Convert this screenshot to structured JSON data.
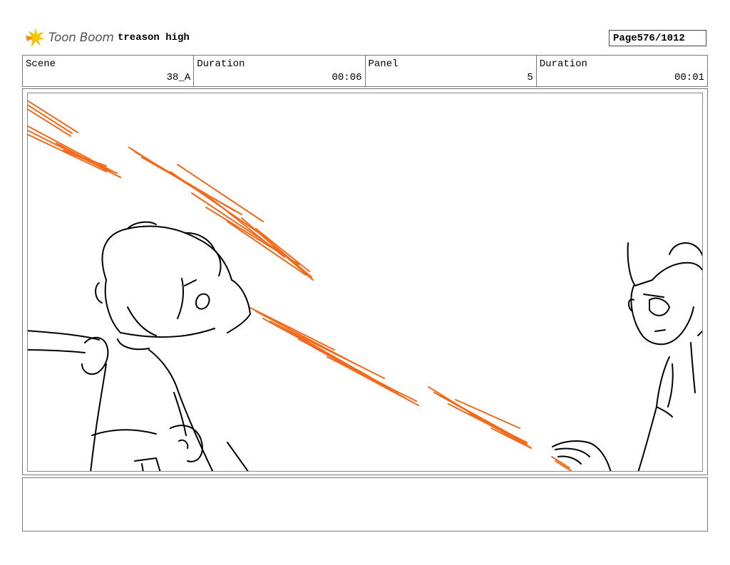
{
  "header": {
    "logo_text": "Toon Boom",
    "project_title": "treason high",
    "page_label": "Page",
    "page_value": "576/1012"
  },
  "info": {
    "scene_label": "Scene",
    "scene_value": "38_A",
    "duration_label": "Duration",
    "duration_value": "00:06",
    "panel_label": "Panel",
    "panel_value": "5",
    "panel_duration_label": "Duration",
    "panel_duration_value": "00:01"
  },
  "notes": {
    "text": ""
  },
  "colors": {
    "fx_orange": "#f26a1b",
    "ink": "#000000",
    "border": "#777777"
  },
  "icons": {
    "logo": "toon-boom-star-icon"
  }
}
